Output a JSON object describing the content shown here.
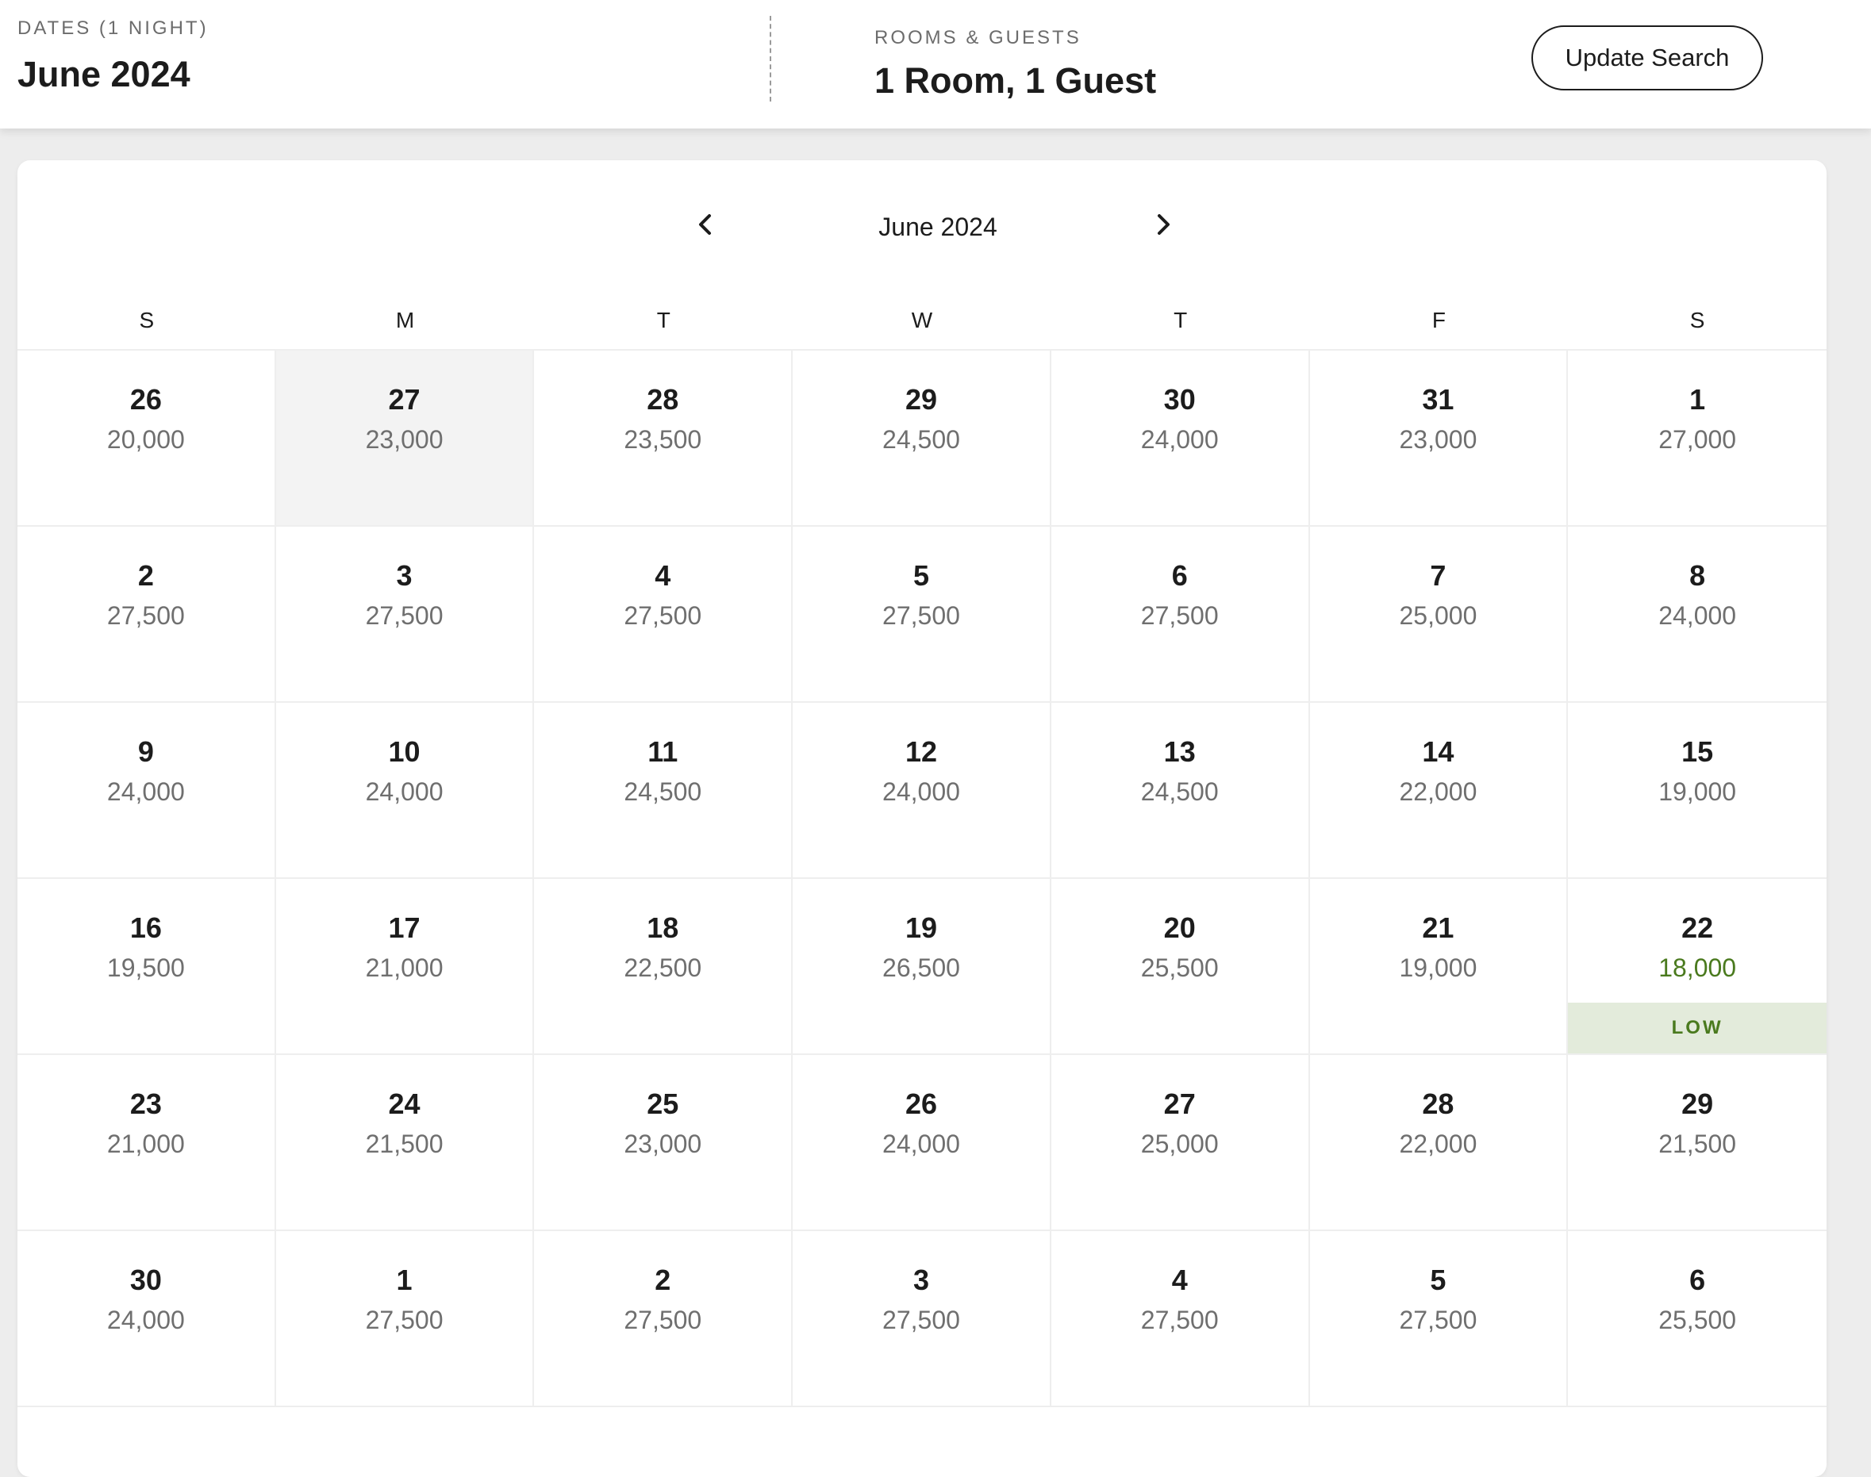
{
  "search": {
    "dates_label": "DATES (1 NIGHT)",
    "dates_value": "June 2024",
    "rooms_label": "ROOMS & GUESTS",
    "rooms_value": "1 Room, 1 Guest",
    "update_button": "Update Search"
  },
  "calendar": {
    "month_title": "June 2024",
    "prev_icon": "chevron-left-icon",
    "next_icon": "chevron-right-icon",
    "weekdays": [
      "S",
      "M",
      "T",
      "W",
      "T",
      "F",
      "S"
    ],
    "low_label": "LOW",
    "colors": {
      "low_price": "#4a7a1e",
      "low_badge_bg": "#e3ebdb",
      "highlight_bg": "#f3f3f3"
    },
    "days": [
      {
        "day": "26",
        "price": "20,000"
      },
      {
        "day": "27",
        "price": "23,000",
        "highlighted": true
      },
      {
        "day": "28",
        "price": "23,500"
      },
      {
        "day": "29",
        "price": "24,500"
      },
      {
        "day": "30",
        "price": "24,000"
      },
      {
        "day": "31",
        "price": "23,000"
      },
      {
        "day": "1",
        "price": "27,000"
      },
      {
        "day": "2",
        "price": "27,500"
      },
      {
        "day": "3",
        "price": "27,500"
      },
      {
        "day": "4",
        "price": "27,500"
      },
      {
        "day": "5",
        "price": "27,500"
      },
      {
        "day": "6",
        "price": "27,500"
      },
      {
        "day": "7",
        "price": "25,000"
      },
      {
        "day": "8",
        "price": "24,000"
      },
      {
        "day": "9",
        "price": "24,000"
      },
      {
        "day": "10",
        "price": "24,000"
      },
      {
        "day": "11",
        "price": "24,500"
      },
      {
        "day": "12",
        "price": "24,000"
      },
      {
        "day": "13",
        "price": "24,500"
      },
      {
        "day": "14",
        "price": "22,000"
      },
      {
        "day": "15",
        "price": "19,000"
      },
      {
        "day": "16",
        "price": "19,500"
      },
      {
        "day": "17",
        "price": "21,000"
      },
      {
        "day": "18",
        "price": "22,500"
      },
      {
        "day": "19",
        "price": "26,500"
      },
      {
        "day": "20",
        "price": "25,500"
      },
      {
        "day": "21",
        "price": "19,000"
      },
      {
        "day": "22",
        "price": "18,000",
        "low": true
      },
      {
        "day": "23",
        "price": "21,000"
      },
      {
        "day": "24",
        "price": "21,500"
      },
      {
        "day": "25",
        "price": "23,000"
      },
      {
        "day": "26",
        "price": "24,000"
      },
      {
        "day": "27",
        "price": "25,000"
      },
      {
        "day": "28",
        "price": "22,000"
      },
      {
        "day": "29",
        "price": "21,500"
      },
      {
        "day": "30",
        "price": "24,000"
      },
      {
        "day": "1",
        "price": "27,500"
      },
      {
        "day": "2",
        "price": "27,500"
      },
      {
        "day": "3",
        "price": "27,500"
      },
      {
        "day": "4",
        "price": "27,500"
      },
      {
        "day": "5",
        "price": "27,500"
      },
      {
        "day": "6",
        "price": "25,500"
      }
    ]
  }
}
